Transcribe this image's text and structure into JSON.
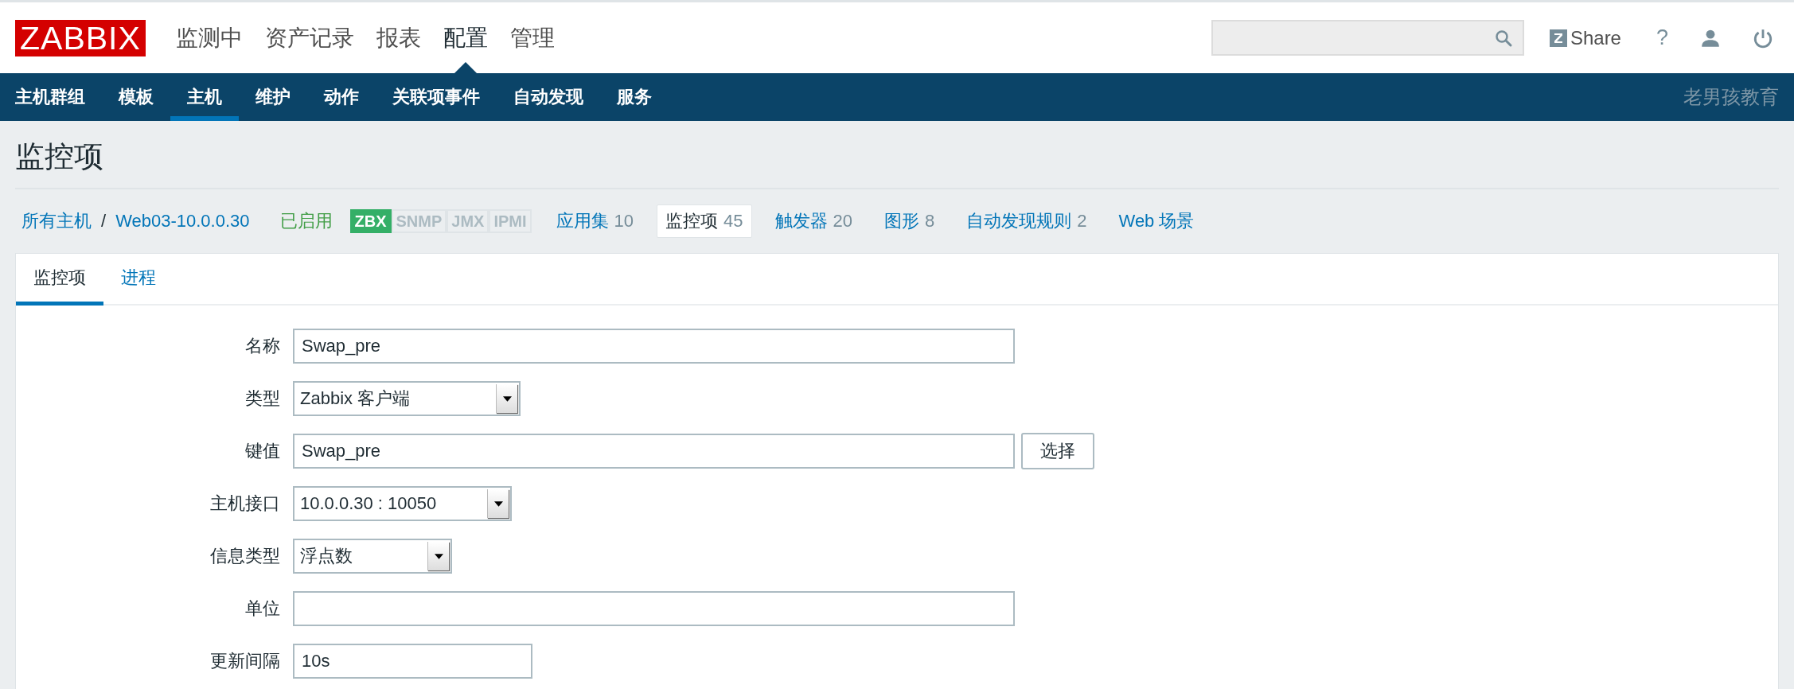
{
  "header": {
    "logo": "ZABBIX",
    "menu": [
      {
        "label": "监测中",
        "selected": false
      },
      {
        "label": "资产记录",
        "selected": false
      },
      {
        "label": "报表",
        "selected": false
      },
      {
        "label": "配置",
        "selected": true
      },
      {
        "label": "管理",
        "selected": false
      }
    ],
    "share": "Share",
    "help": "?"
  },
  "submenu": {
    "items": [
      {
        "label": "主机群组",
        "selected": false
      },
      {
        "label": "模板",
        "selected": false
      },
      {
        "label": "主机",
        "selected": true
      },
      {
        "label": "维护",
        "selected": false
      },
      {
        "label": "动作",
        "selected": false
      },
      {
        "label": "关联项事件",
        "selected": false
      },
      {
        "label": "自动发现",
        "selected": false
      },
      {
        "label": "服务",
        "selected": false
      }
    ],
    "brand": "老男孩教育"
  },
  "page_title": "监控项",
  "host_nav": {
    "breadcrumb": [
      "所有主机",
      "Web03-10.0.0.30"
    ],
    "breadcrumb_separator": "/",
    "status": "已启用",
    "availability": [
      {
        "label": "ZBX",
        "on": true
      },
      {
        "label": "SNMP",
        "on": false
      },
      {
        "label": "JMX",
        "on": false
      },
      {
        "label": "IPMI",
        "on": false
      }
    ],
    "links": [
      {
        "label": "应用集",
        "count": "10",
        "selected": false
      },
      {
        "label": "监控项",
        "count": "45",
        "selected": true
      },
      {
        "label": "触发器",
        "count": "20",
        "selected": false
      },
      {
        "label": "图形",
        "count": "8",
        "selected": false
      },
      {
        "label": "自动发现规则",
        "count": "2",
        "selected": false
      },
      {
        "label": "Web 场景",
        "selected": false
      }
    ]
  },
  "form": {
    "tabs": [
      {
        "label": "监控项",
        "selected": true
      },
      {
        "label": "进程",
        "selected": false
      }
    ],
    "fields": [
      {
        "label": "名称",
        "kind": "text",
        "value": "Swap_pre"
      },
      {
        "label": "类型",
        "kind": "select",
        "value": "Zabbix 客户端"
      },
      {
        "label": "键值",
        "kind": "text",
        "value": "Swap_pre",
        "button": "选择"
      },
      {
        "label": "主机接口",
        "kind": "select",
        "value": "10.0.0.30 : 10050"
      },
      {
        "label": "信息类型",
        "kind": "select",
        "value": "浮点数"
      },
      {
        "label": "单位",
        "kind": "text"
      },
      {
        "label": "更新间隔",
        "kind": "text",
        "value": "10s"
      }
    ]
  }
}
